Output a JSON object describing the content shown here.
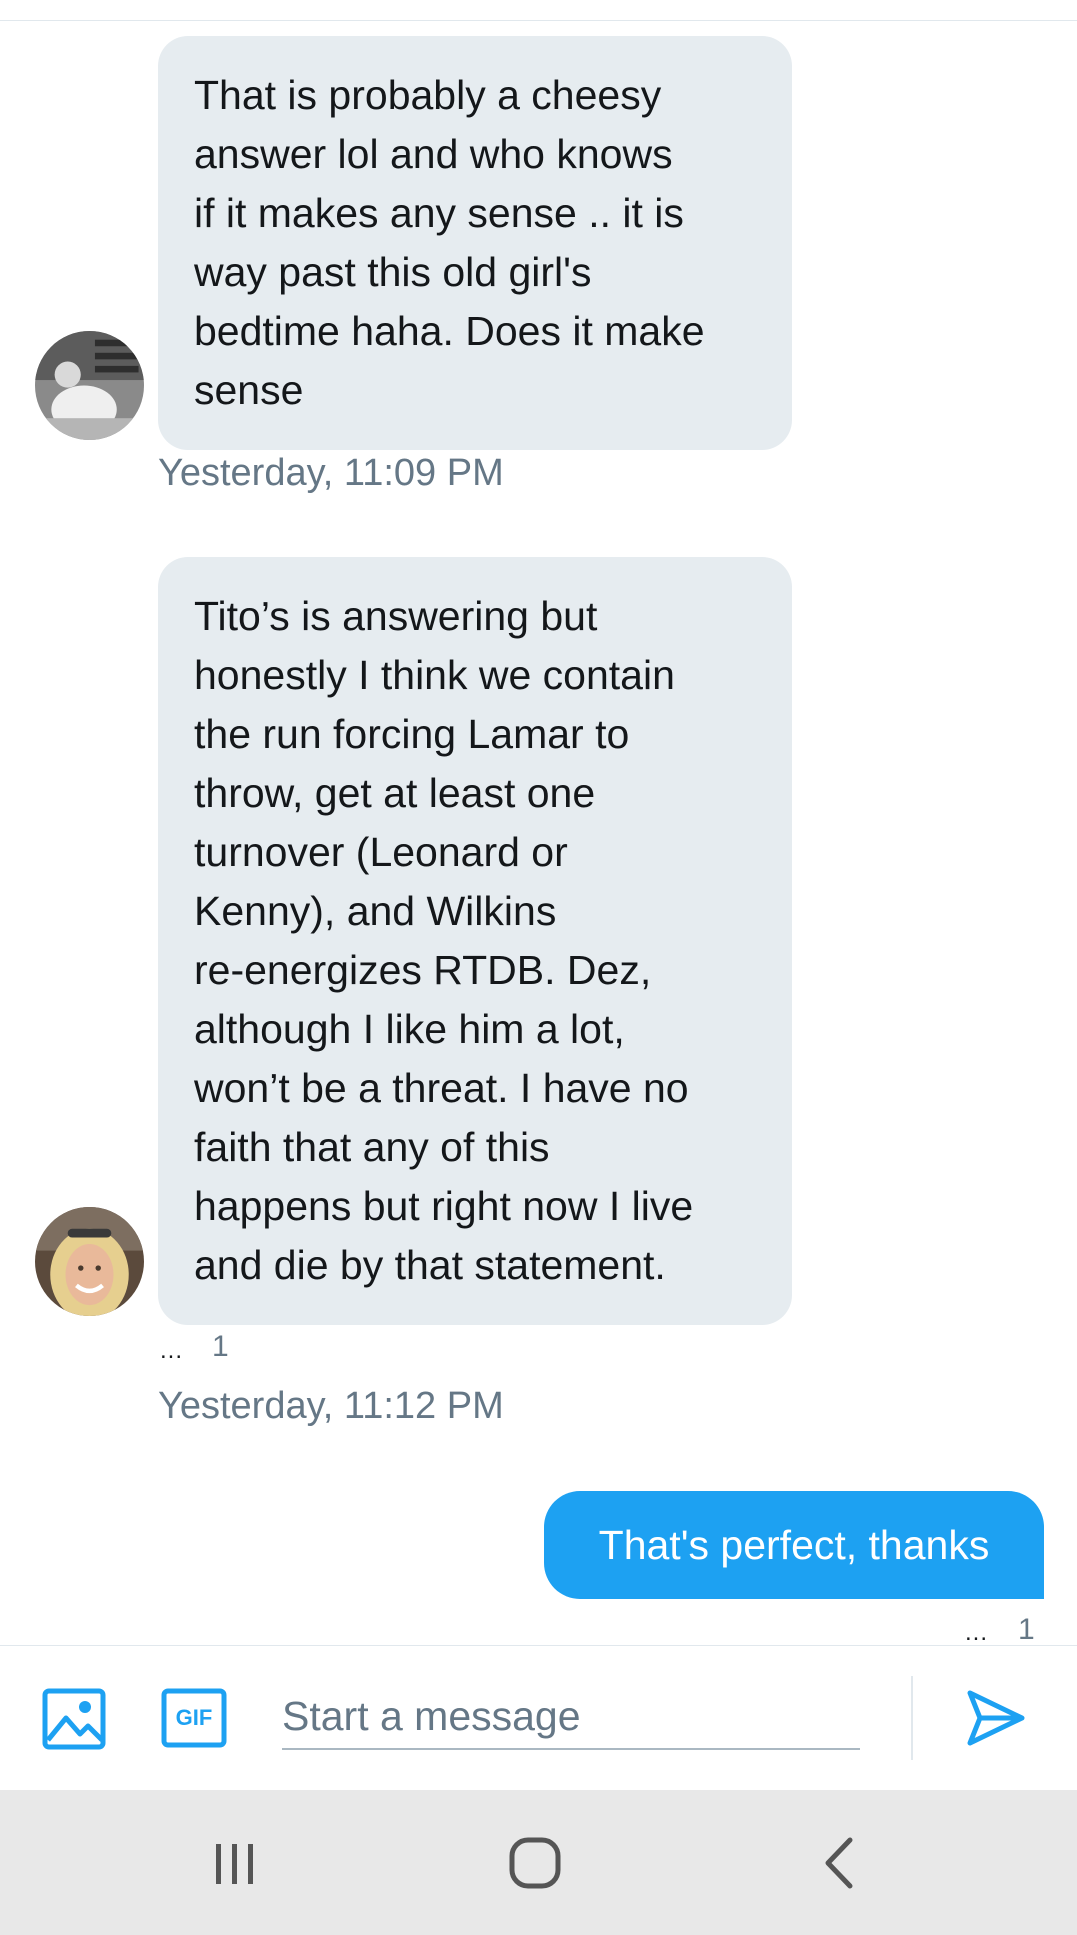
{
  "messages": [
    {
      "direction": "incoming",
      "lines": [
        "That is probably a cheesy",
        "answer lol and who knows",
        "if it makes any sense .. it is",
        "way past this old girl's",
        "bedtime haha. Does it make",
        "sense"
      ],
      "timestamp": "Yesterday, 11:09 PM"
    },
    {
      "direction": "incoming",
      "lines": [
        "Tito’s is answering but",
        "honestly I think we contain",
        "the run forcing Lamar to",
        "throw, get at least one",
        "turnover (Leonard or",
        "Kenny), and Wilkins",
        "re-energizes RTDB. Dez,",
        "although I like him a lot,",
        "won’t be a threat. I have no",
        "faith that any of this",
        "happens but right now I live",
        "and die by that statement."
      ],
      "reaction_dots": "...",
      "reaction_count": "1",
      "timestamp": "Yesterday, 11:12 PM"
    },
    {
      "direction": "outgoing",
      "text": "That's perfect, thanks",
      "reaction_dots": "...",
      "reaction_count": "1"
    }
  ],
  "composer": {
    "placeholder": "Start a message",
    "image_icon": "image-icon",
    "gif_label": "GIF",
    "send_icon": "send-icon"
  },
  "navbar": {
    "recents_icon": "recents-icon",
    "home_icon": "home-icon",
    "back_icon": "back-icon"
  },
  "colors": {
    "accent": "#1da1f2",
    "bubble_incoming": "#e6ecf0",
    "secondary_text": "#657786"
  }
}
